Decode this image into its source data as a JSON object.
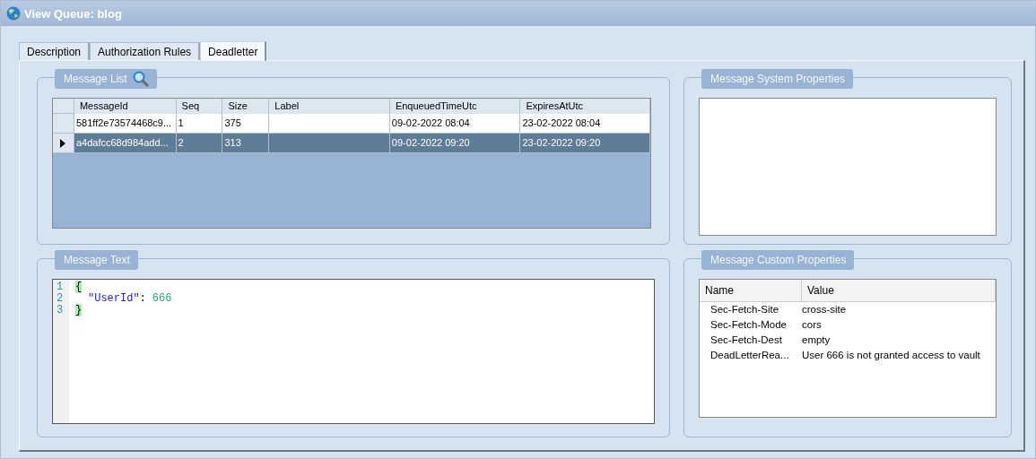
{
  "window": {
    "title": "View Queue: blog"
  },
  "tabs": [
    {
      "label": "Description",
      "selected": false
    },
    {
      "label": "Authorization Rules",
      "selected": false
    },
    {
      "label": "Deadletter",
      "selected": true
    }
  ],
  "message_list": {
    "title": "Message List",
    "columns": [
      "MessageId",
      "Seq",
      "Size",
      "Label",
      "EnqueuedTimeUtc",
      "ExpiresAtUtc"
    ],
    "rows": [
      {
        "cells": [
          "581ff2e73574468c9...",
          "1",
          "375",
          "",
          "09-02-2022 08:04",
          "23-02-2022 08:04"
        ],
        "selected": false
      },
      {
        "cells": [
          "a4dafcc68d984add...",
          "2",
          "313",
          "",
          "09-02-2022 09:20",
          "23-02-2022 09:20"
        ],
        "selected": true
      }
    ]
  },
  "message_text": {
    "title": "Message Text",
    "lines": [
      {
        "number": "1",
        "indented": false,
        "tokens": [
          {
            "kind": "brace",
            "text": "{"
          }
        ]
      },
      {
        "number": "2",
        "indented": true,
        "tokens": [
          {
            "kind": "key",
            "text": "\"UserId\""
          },
          {
            "kind": "punct",
            "text": ":"
          },
          {
            "kind": "number",
            "text": "666"
          }
        ]
      },
      {
        "number": "3",
        "indented": false,
        "tokens": [
          {
            "kind": "brace",
            "text": "}"
          }
        ]
      }
    ]
  },
  "system_properties": {
    "title": "Message System Properties"
  },
  "custom_properties": {
    "title": "Message Custom Properties",
    "columns": [
      "Name",
      "Value"
    ],
    "rows": [
      {
        "name": "Sec-Fetch-Site",
        "value": "cross-site"
      },
      {
        "name": "Sec-Fetch-Mode",
        "value": "cors"
      },
      {
        "name": "Sec-Fetch-Dest",
        "value": "empty"
      },
      {
        "name": "DeadLetterRea...",
        "value": "User 666 is not granted access to vault"
      }
    ]
  }
}
